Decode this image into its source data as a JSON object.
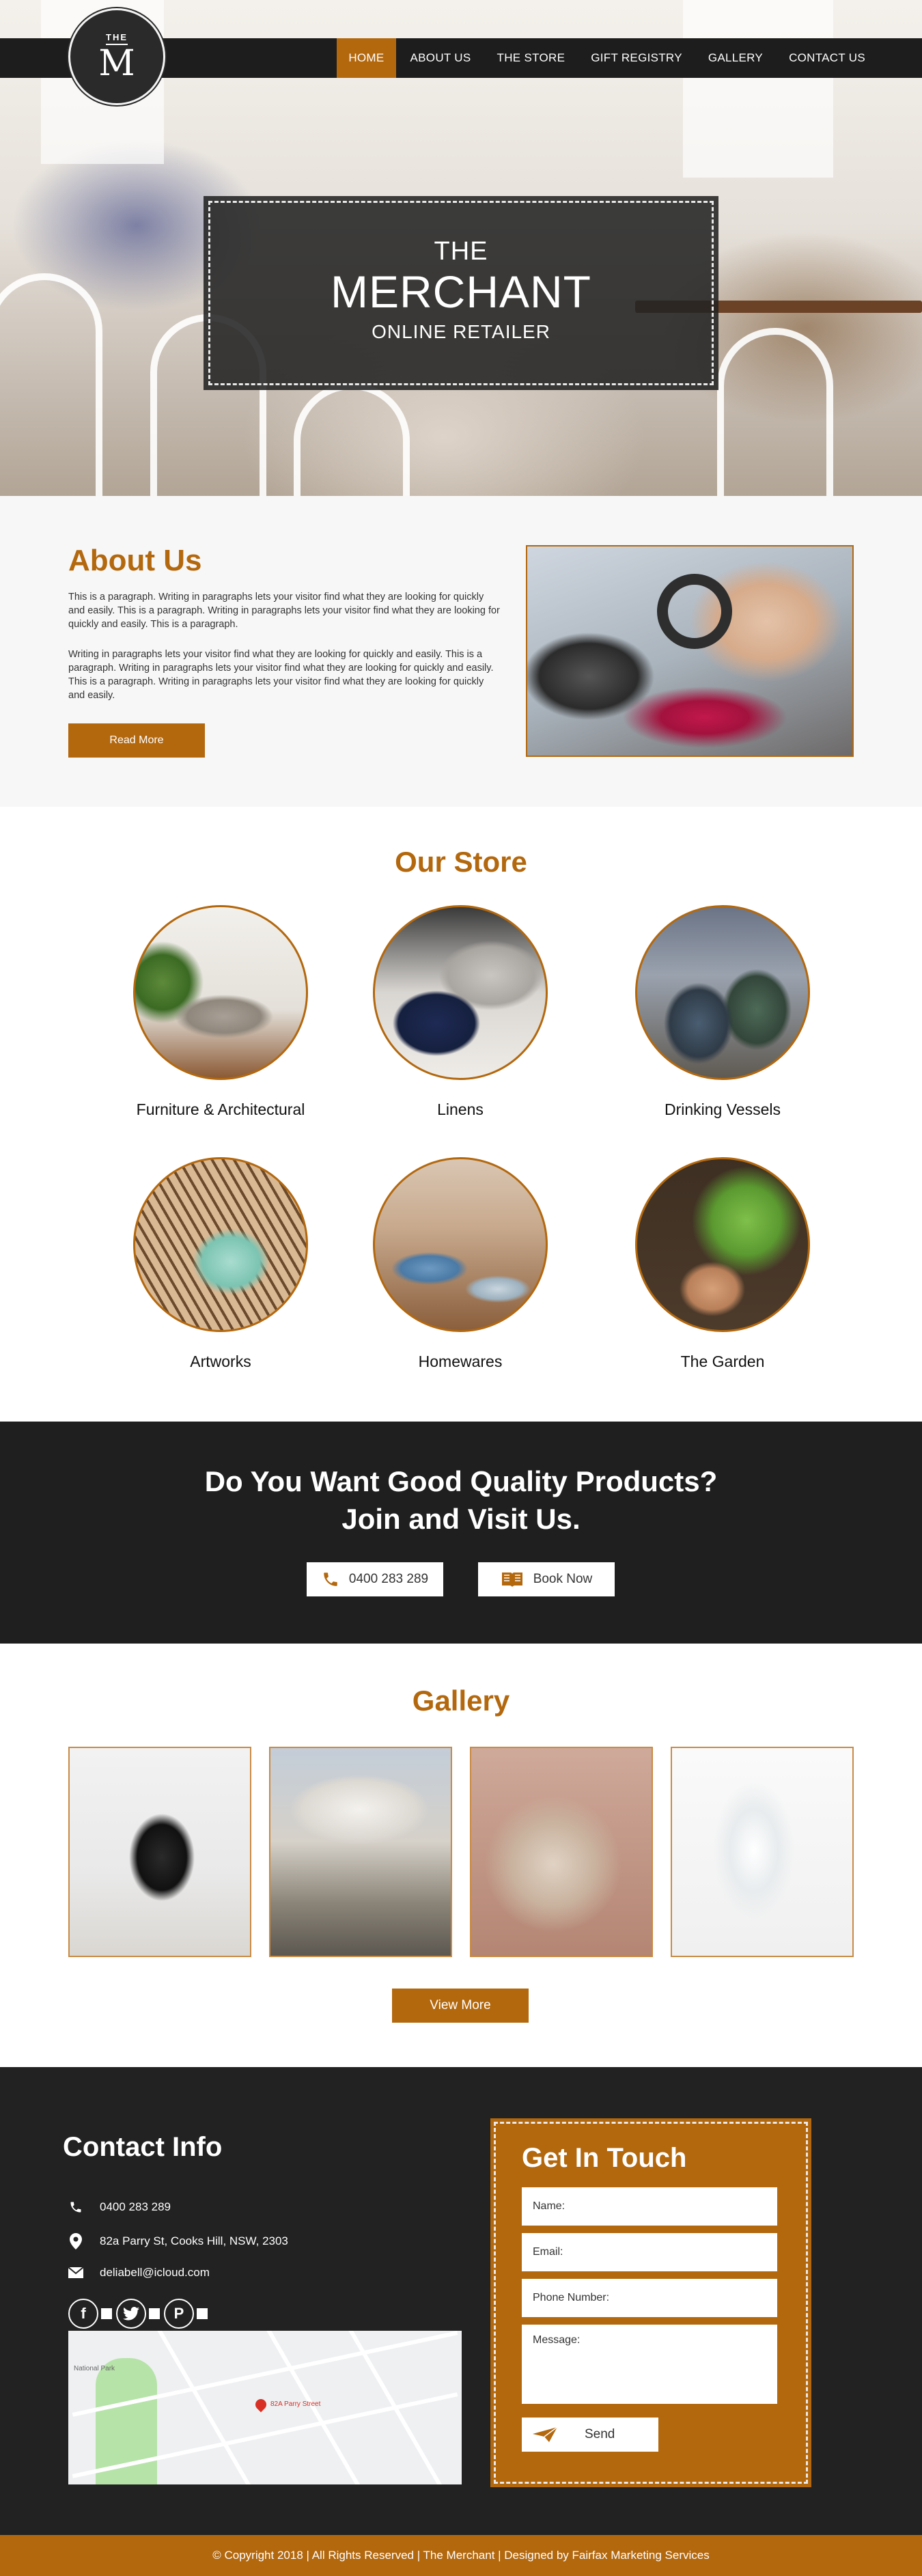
{
  "brand": {
    "logo_top": "THE",
    "logo_letter": "M"
  },
  "nav": {
    "items": [
      {
        "label": "HOME",
        "active": true
      },
      {
        "label": "ABOUT US",
        "active": false
      },
      {
        "label": "THE STORE",
        "active": false
      },
      {
        "label": "GIFT REGISTRY",
        "active": false
      },
      {
        "label": "GALLERY",
        "active": false
      },
      {
        "label": "CONTACT US",
        "active": false
      }
    ]
  },
  "hero": {
    "line1": "THE",
    "line2": "MERCHANT",
    "line3": "ONLINE RETAILER"
  },
  "about": {
    "title": "About Us",
    "paragraph1": "This is a paragraph. Writing in paragraphs lets your visitor find what they are looking for quickly and easily. This is a paragraph. Writing in paragraphs lets your visitor find what they are looking for quickly and easily. This is a paragraph.",
    "paragraph2": "Writing in paragraphs lets your visitor find what they are looking for quickly and easily. This is a paragraph. Writing in paragraphs lets your visitor find what they are looking for quickly and easily. This is a paragraph. Writing in paragraphs lets your visitor find what they are looking for quickly and easily.",
    "button": "Read More"
  },
  "store": {
    "title": "Our Store",
    "categories": [
      {
        "label": "Furniture & Architectural"
      },
      {
        "label": "Linens"
      },
      {
        "label": "Drinking Vessels"
      },
      {
        "label": "Artworks"
      },
      {
        "label": "Homewares"
      },
      {
        "label": "The Garden"
      }
    ]
  },
  "cta": {
    "title_line1": "Do You Want Good Quality Products?",
    "title_line2": "Join and Visit Us.",
    "phone_button": "0400 283 289",
    "book_button": "Book Now"
  },
  "gallery": {
    "title": "Gallery",
    "button": "View More"
  },
  "contact": {
    "title": "Contact Info",
    "phone": "0400 283 289",
    "address": "82a Parry St, Cooks Hill, NSW, 2303",
    "email": "deliabell@icloud.com",
    "socials": [
      "facebook-icon",
      "twitter-icon",
      "pinterest-icon"
    ],
    "map": {
      "area_label": "National Park",
      "pin_label": "82A Parry Street"
    }
  },
  "touch": {
    "title": "Get In Touch",
    "name_placeholder": "Name:",
    "email_placeholder": "Email:",
    "phone_placeholder": "Phone Number:",
    "message_placeholder": "Message:",
    "send": "Send"
  },
  "footer": {
    "copyright": "© Copyright 2018 | All Rights Reserved | The Merchant | Designed by Fairfax Marketing Services"
  },
  "colors": {
    "accent": "#b3680e",
    "dark": "#1d1d1d",
    "footer_bg": "#222222"
  }
}
